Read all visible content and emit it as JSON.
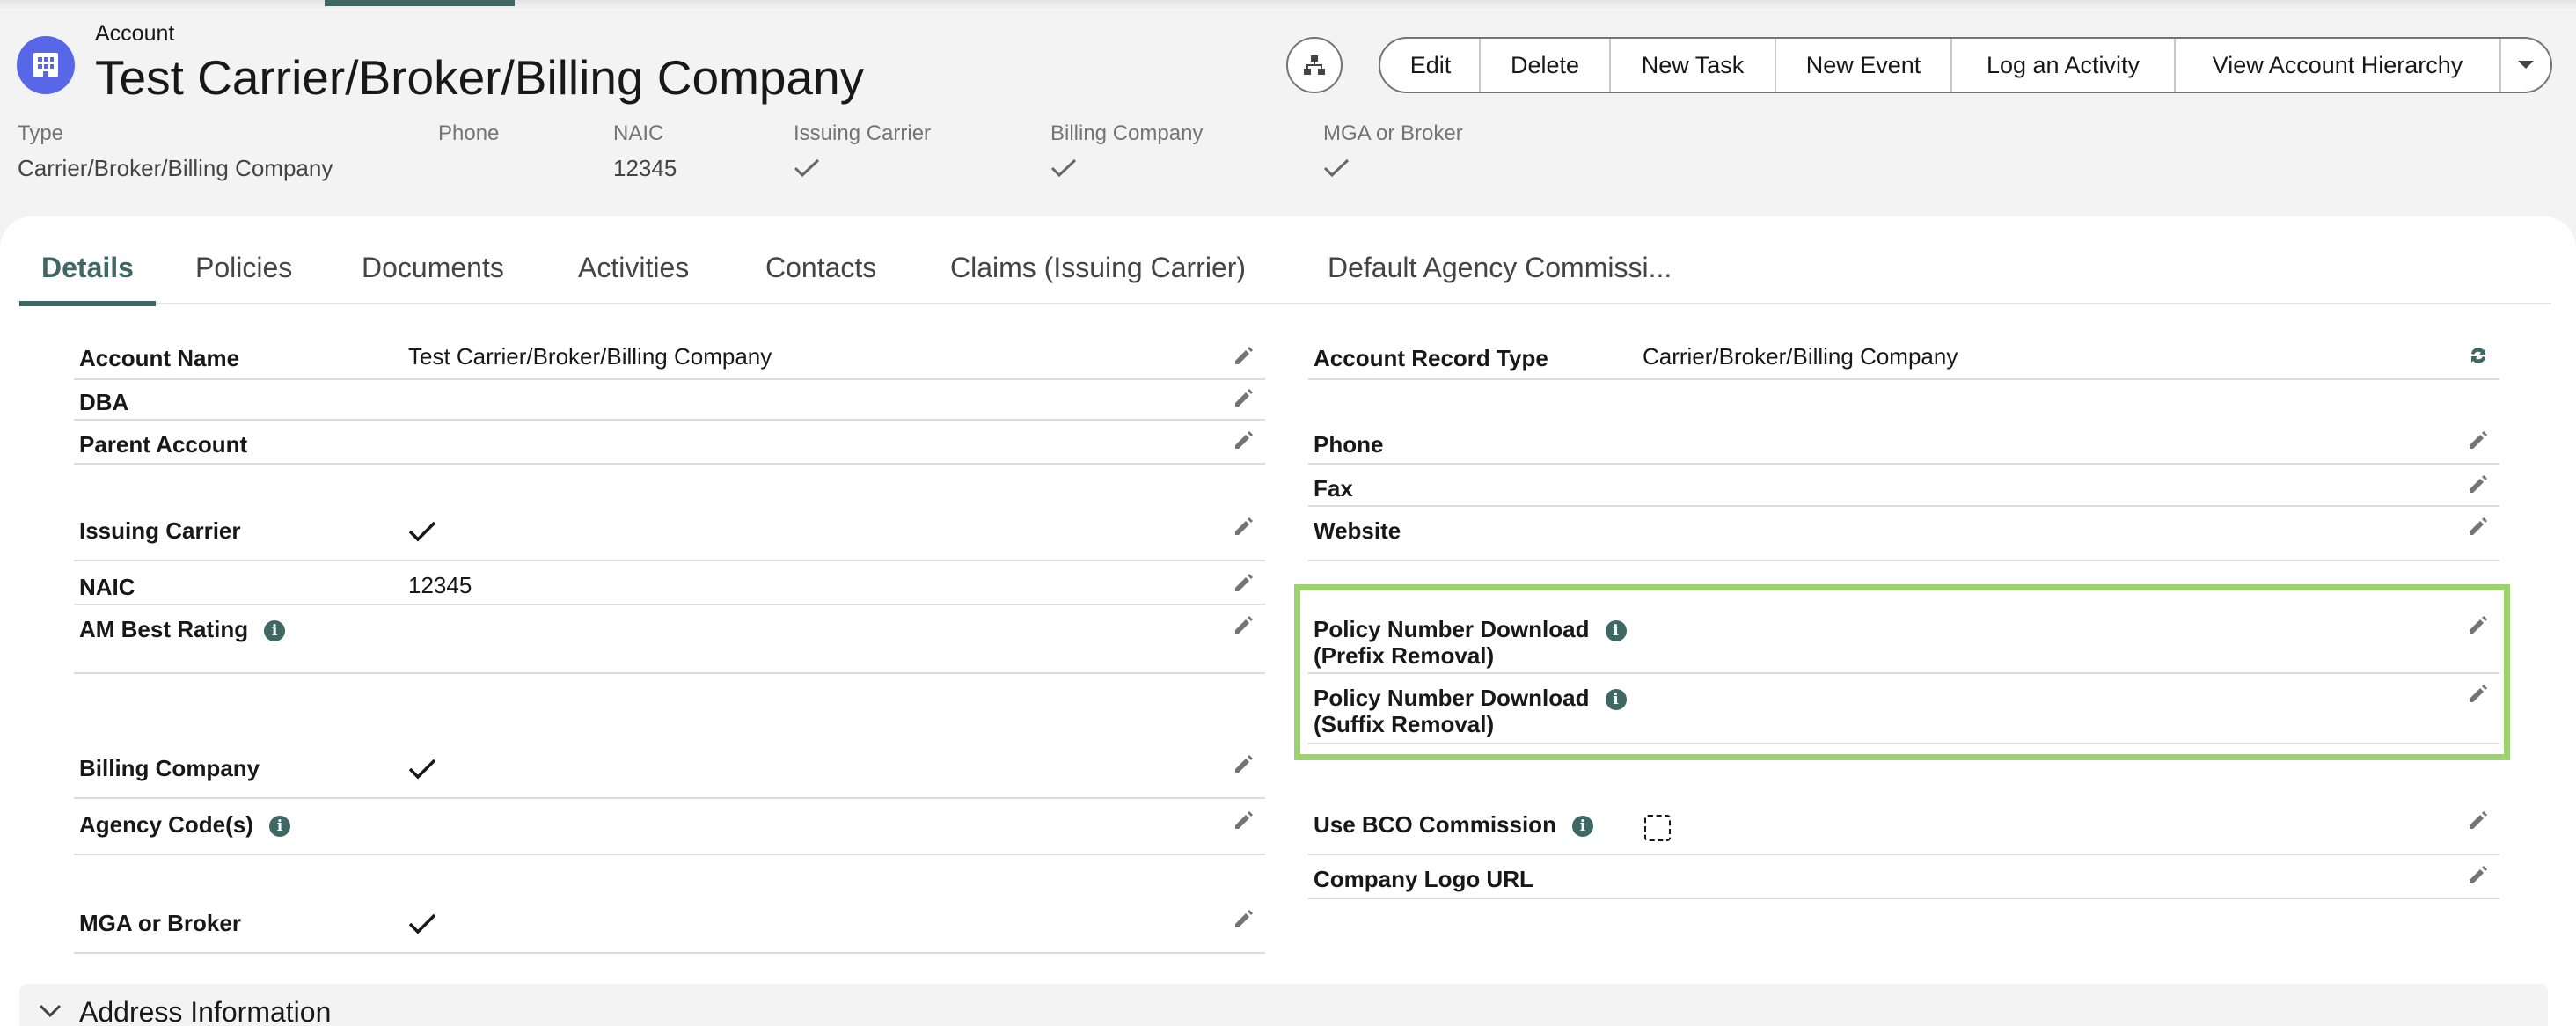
{
  "header": {
    "object_type": "Account",
    "record_name": "Test Carrier/Broker/Billing Company",
    "icon": "building-icon",
    "buttons": [
      "Edit",
      "Delete",
      "New Task",
      "New Event",
      "Log an Activity",
      "View Account Hierarchy"
    ],
    "hierarchy_icon": "hierarchy-icon",
    "more_icon": "chevron-down-icon"
  },
  "highlights": {
    "type_label": "Type",
    "type_value": "Carrier/Broker/Billing Company",
    "phone_label": "Phone",
    "naic_label": "NAIC",
    "naic_value": "12345",
    "issuing_label": "Issuing Carrier",
    "billing_label": "Billing Company",
    "mga_label": "MGA or Broker"
  },
  "tabs": [
    "Details",
    "Policies",
    "Documents",
    "Activities",
    "Contacts",
    "Claims (Issuing Carrier)",
    "Default Agency Commissi..."
  ],
  "left_fields": {
    "account_name": {
      "label": "Account Name",
      "value": "Test Carrier/Broker/Billing Company"
    },
    "dba": {
      "label": "DBA"
    },
    "parent_account": {
      "label": "Parent Account"
    },
    "issuing_carrier": {
      "label": "Issuing Carrier",
      "checked": true
    },
    "naic": {
      "label": "NAIC",
      "value": "12345"
    },
    "am_best": {
      "label": "AM Best Rating"
    },
    "billing_company": {
      "label": "Billing Company",
      "checked": true
    },
    "agency_codes": {
      "label": "Agency Code(s)"
    },
    "mga_broker": {
      "label": "MGA or Broker",
      "checked": true
    }
  },
  "right_fields": {
    "record_type": {
      "label": "Account Record Type",
      "value": "Carrier/Broker/Billing Company"
    },
    "phone": {
      "label": "Phone"
    },
    "fax": {
      "label": "Fax"
    },
    "website": {
      "label": "Website"
    },
    "prefix": {
      "label_1": "Policy Number Download",
      "label_2": "(Prefix Removal)"
    },
    "suffix": {
      "label_1": "Policy Number Download",
      "label_2": "(Suffix Removal)"
    },
    "bco": {
      "label": "Use BCO Commission",
      "checked": false
    },
    "logo_url": {
      "label": "Company Logo URL"
    }
  },
  "section": {
    "title": "Address Information"
  },
  "colors": {
    "accent": "#3f6864",
    "icon_bg": "#5867e8",
    "highlight": "#9bd36c"
  }
}
